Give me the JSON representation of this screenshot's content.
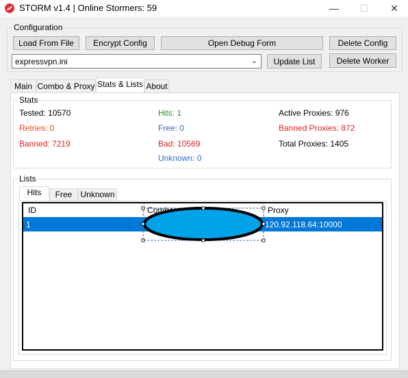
{
  "window": {
    "title": "STORM v1.4 | Online Stormers: 59",
    "minimize_glyph": "—",
    "maximize_glyph": "☐",
    "close_glyph": "✕",
    "icon": "storm-logo-icon"
  },
  "configuration": {
    "group_label": "Configuration",
    "load_from_file": "Load From File",
    "encrypt_config": "Encrypt Config",
    "open_debug_form": "Open Debug Form",
    "delete_config": "Delete Config",
    "selected_config": "expressvpn.ini",
    "update_list": "Update List",
    "delete_worker": "Delete Worker"
  },
  "tabs": [
    "Main",
    "Combo & Proxy",
    "Stats & Lists",
    "About"
  ],
  "active_tab": "Stats & Lists",
  "stats": {
    "group_label": "Stats",
    "tested": "Tested: 10570",
    "retries": "Retries: 0",
    "banned": "Banned: 7219",
    "hits": "Hits: 1",
    "free": "Free: 0",
    "bad": "Bad: 10569",
    "unknown": "Unknown: 0",
    "active_proxies": "Active Proxies: 976",
    "banned_proxies": "Banned Proxies: 872",
    "total_proxies": "Total Proxies: 1405"
  },
  "lists": {
    "group_label": "Lists",
    "tabs": [
      "Hits",
      "Free",
      "Unknown"
    ],
    "active_tab": "Hits",
    "columns": [
      "ID",
      "Combo",
      "Proxy"
    ],
    "rows": [
      {
        "id": "1",
        "combo": "",
        "proxy": "120.92.118.64:10000"
      }
    ]
  },
  "colors": {
    "selection": "#0078d7",
    "redaction_fill": "#00a2e8",
    "red": "#e02020",
    "green": "#2c8a2c",
    "blue": "#2f6fd6"
  }
}
